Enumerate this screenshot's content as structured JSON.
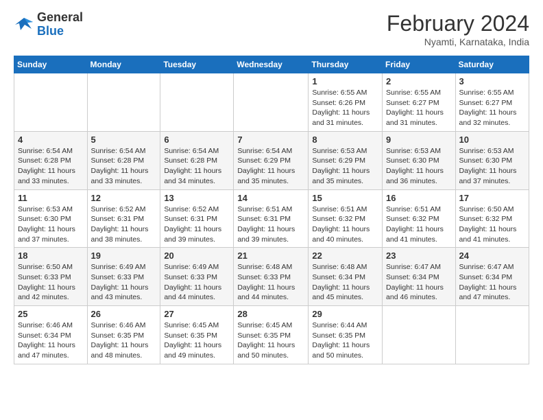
{
  "logo": {
    "line1": "General",
    "line2": "Blue"
  },
  "title": "February 2024",
  "location": "Nyamti, Karnataka, India",
  "days_of_week": [
    "Sunday",
    "Monday",
    "Tuesday",
    "Wednesday",
    "Thursday",
    "Friday",
    "Saturday"
  ],
  "weeks": [
    [
      {
        "day": "",
        "info": ""
      },
      {
        "day": "",
        "info": ""
      },
      {
        "day": "",
        "info": ""
      },
      {
        "day": "",
        "info": ""
      },
      {
        "day": "1",
        "info": "Sunrise: 6:55 AM\nSunset: 6:26 PM\nDaylight: 11 hours and 31 minutes."
      },
      {
        "day": "2",
        "info": "Sunrise: 6:55 AM\nSunset: 6:27 PM\nDaylight: 11 hours and 31 minutes."
      },
      {
        "day": "3",
        "info": "Sunrise: 6:55 AM\nSunset: 6:27 PM\nDaylight: 11 hours and 32 minutes."
      }
    ],
    [
      {
        "day": "4",
        "info": "Sunrise: 6:54 AM\nSunset: 6:28 PM\nDaylight: 11 hours and 33 minutes."
      },
      {
        "day": "5",
        "info": "Sunrise: 6:54 AM\nSunset: 6:28 PM\nDaylight: 11 hours and 33 minutes."
      },
      {
        "day": "6",
        "info": "Sunrise: 6:54 AM\nSunset: 6:28 PM\nDaylight: 11 hours and 34 minutes."
      },
      {
        "day": "7",
        "info": "Sunrise: 6:54 AM\nSunset: 6:29 PM\nDaylight: 11 hours and 35 minutes."
      },
      {
        "day": "8",
        "info": "Sunrise: 6:53 AM\nSunset: 6:29 PM\nDaylight: 11 hours and 35 minutes."
      },
      {
        "day": "9",
        "info": "Sunrise: 6:53 AM\nSunset: 6:30 PM\nDaylight: 11 hours and 36 minutes."
      },
      {
        "day": "10",
        "info": "Sunrise: 6:53 AM\nSunset: 6:30 PM\nDaylight: 11 hours and 37 minutes."
      }
    ],
    [
      {
        "day": "11",
        "info": "Sunrise: 6:53 AM\nSunset: 6:30 PM\nDaylight: 11 hours and 37 minutes."
      },
      {
        "day": "12",
        "info": "Sunrise: 6:52 AM\nSunset: 6:31 PM\nDaylight: 11 hours and 38 minutes."
      },
      {
        "day": "13",
        "info": "Sunrise: 6:52 AM\nSunset: 6:31 PM\nDaylight: 11 hours and 39 minutes."
      },
      {
        "day": "14",
        "info": "Sunrise: 6:51 AM\nSunset: 6:31 PM\nDaylight: 11 hours and 39 minutes."
      },
      {
        "day": "15",
        "info": "Sunrise: 6:51 AM\nSunset: 6:32 PM\nDaylight: 11 hours and 40 minutes."
      },
      {
        "day": "16",
        "info": "Sunrise: 6:51 AM\nSunset: 6:32 PM\nDaylight: 11 hours and 41 minutes."
      },
      {
        "day": "17",
        "info": "Sunrise: 6:50 AM\nSunset: 6:32 PM\nDaylight: 11 hours and 41 minutes."
      }
    ],
    [
      {
        "day": "18",
        "info": "Sunrise: 6:50 AM\nSunset: 6:33 PM\nDaylight: 11 hours and 42 minutes."
      },
      {
        "day": "19",
        "info": "Sunrise: 6:49 AM\nSunset: 6:33 PM\nDaylight: 11 hours and 43 minutes."
      },
      {
        "day": "20",
        "info": "Sunrise: 6:49 AM\nSunset: 6:33 PM\nDaylight: 11 hours and 44 minutes."
      },
      {
        "day": "21",
        "info": "Sunrise: 6:48 AM\nSunset: 6:33 PM\nDaylight: 11 hours and 44 minutes."
      },
      {
        "day": "22",
        "info": "Sunrise: 6:48 AM\nSunset: 6:34 PM\nDaylight: 11 hours and 45 minutes."
      },
      {
        "day": "23",
        "info": "Sunrise: 6:47 AM\nSunset: 6:34 PM\nDaylight: 11 hours and 46 minutes."
      },
      {
        "day": "24",
        "info": "Sunrise: 6:47 AM\nSunset: 6:34 PM\nDaylight: 11 hours and 47 minutes."
      }
    ],
    [
      {
        "day": "25",
        "info": "Sunrise: 6:46 AM\nSunset: 6:34 PM\nDaylight: 11 hours and 47 minutes."
      },
      {
        "day": "26",
        "info": "Sunrise: 6:46 AM\nSunset: 6:35 PM\nDaylight: 11 hours and 48 minutes."
      },
      {
        "day": "27",
        "info": "Sunrise: 6:45 AM\nSunset: 6:35 PM\nDaylight: 11 hours and 49 minutes."
      },
      {
        "day": "28",
        "info": "Sunrise: 6:45 AM\nSunset: 6:35 PM\nDaylight: 11 hours and 50 minutes."
      },
      {
        "day": "29",
        "info": "Sunrise: 6:44 AM\nSunset: 6:35 PM\nDaylight: 11 hours and 50 minutes."
      },
      {
        "day": "",
        "info": ""
      },
      {
        "day": "",
        "info": ""
      }
    ]
  ]
}
